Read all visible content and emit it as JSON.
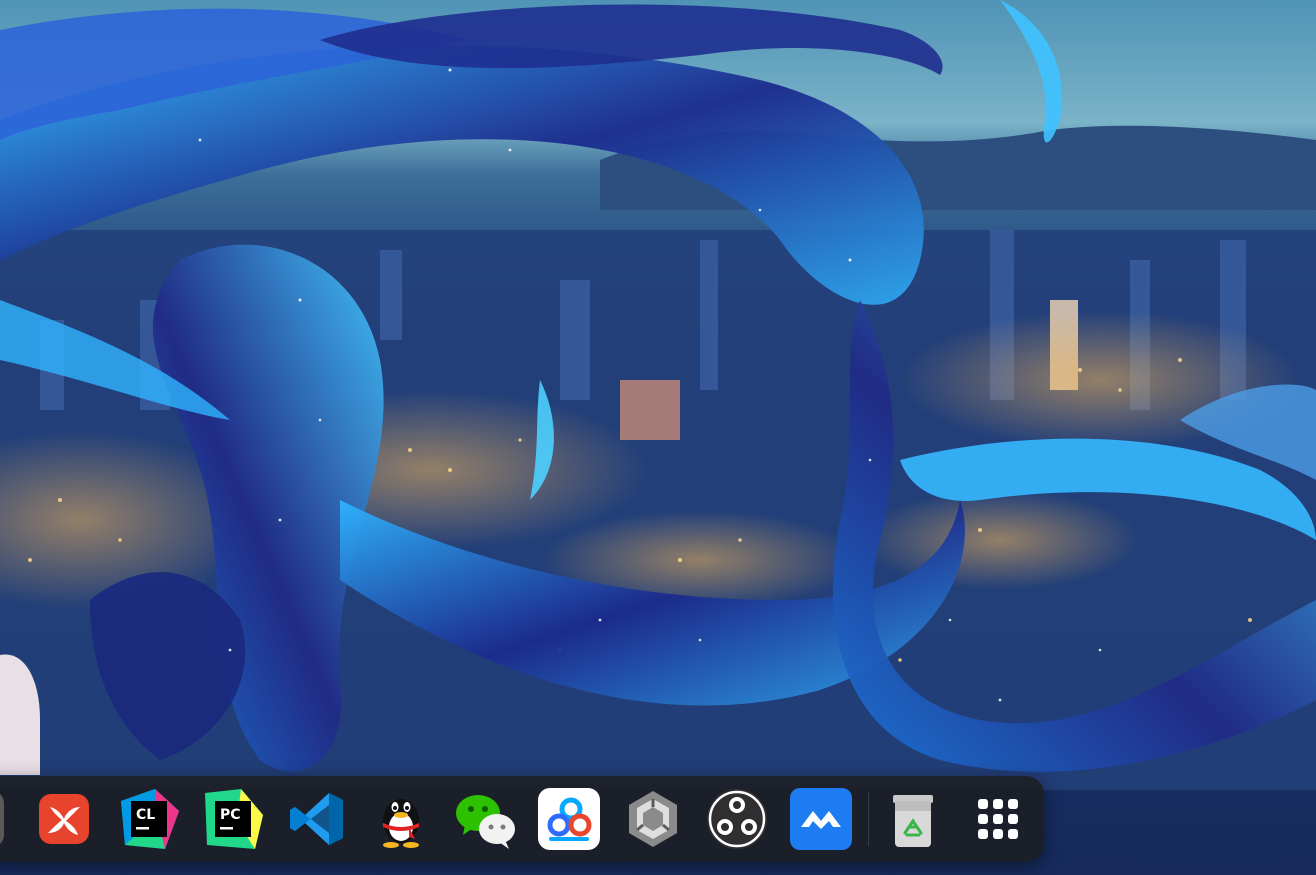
{
  "desktop": {
    "wallpaper_icon": "anime-city-night-wallpaper",
    "colors": {
      "sky": "#6aa6c4",
      "hair_dark": "#1a1a6e",
      "hair_bright": "#2fb4ff",
      "city_light": "#f5b342",
      "dock_background": "#1c1e26"
    }
  },
  "dock": {
    "items": [
      {
        "name": "partial-app",
        "icon": "partial-app-icon"
      },
      {
        "name": "xmind",
        "icon": "xmind-icon"
      },
      {
        "name": "clion",
        "icon": "clion-icon",
        "badge_text": "CL"
      },
      {
        "name": "pycharm",
        "icon": "pycharm-icon",
        "badge_text": "PC"
      },
      {
        "name": "visual-studio-code",
        "icon": "vscode-icon"
      },
      {
        "name": "qq",
        "icon": "qq-penguin-icon"
      },
      {
        "name": "wechat",
        "icon": "wechat-icon"
      },
      {
        "name": "baidu-netdisk",
        "icon": "baidu-netdisk-icon"
      },
      {
        "name": "unity",
        "icon": "unity-icon"
      },
      {
        "name": "obs-studio",
        "icon": "obs-icon"
      },
      {
        "name": "tencent-meeting",
        "icon": "tencent-meeting-icon"
      },
      {
        "name": "trash",
        "icon": "recycle-bin-icon"
      },
      {
        "name": "launcher",
        "icon": "app-grid-icon"
      }
    ]
  }
}
